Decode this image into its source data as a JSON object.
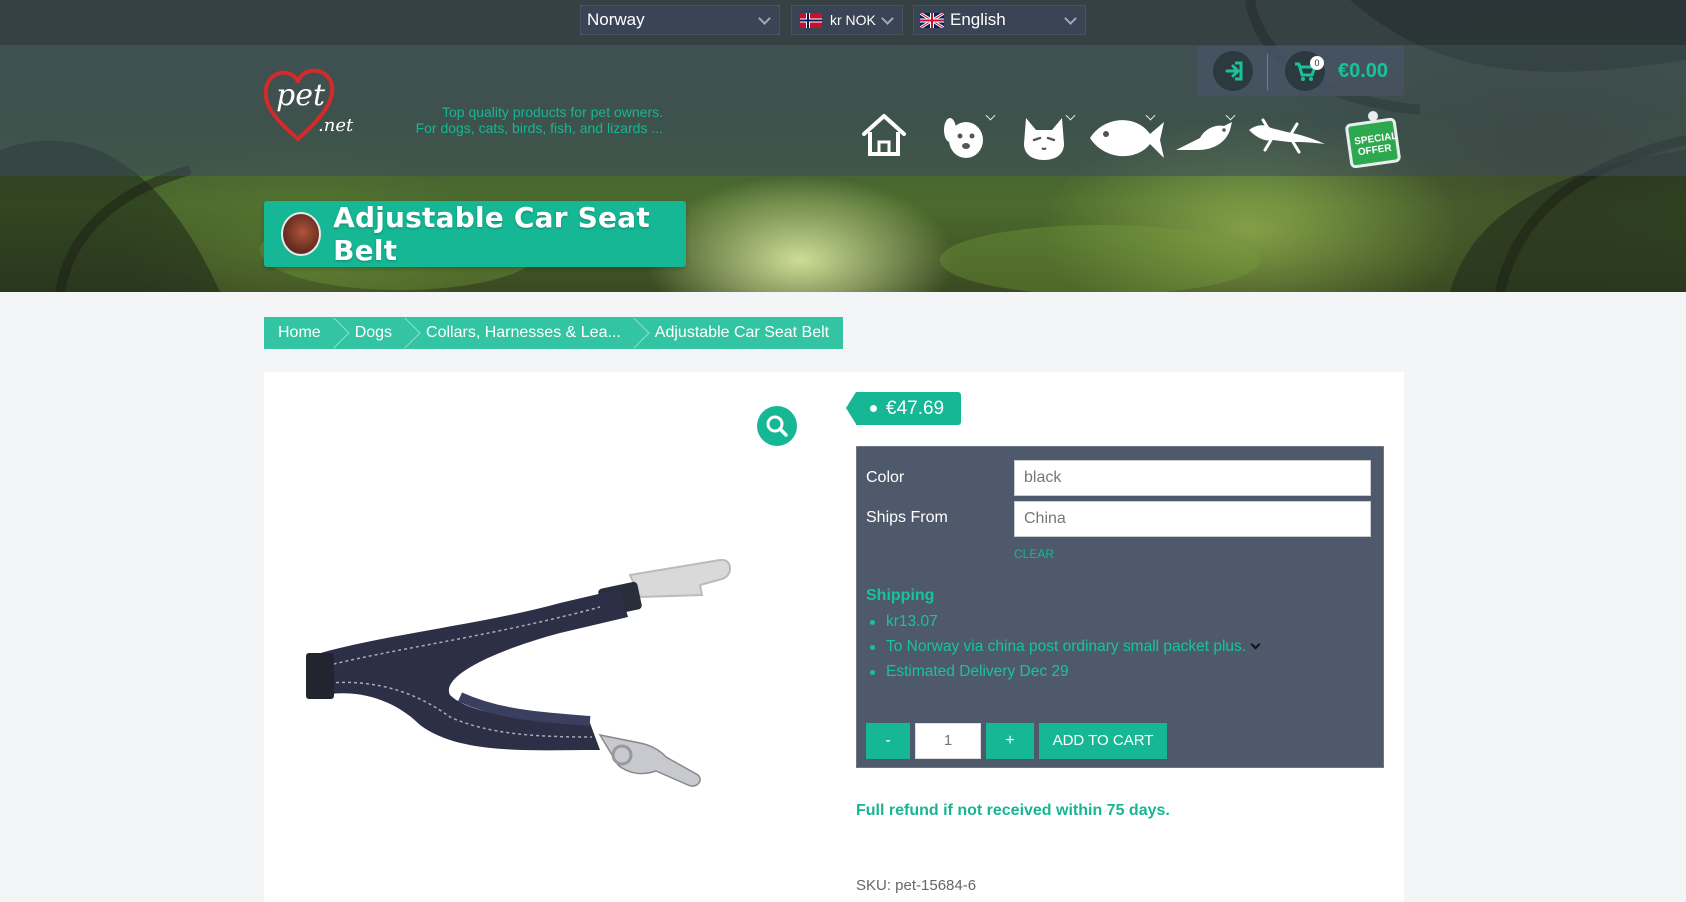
{
  "topbar": {
    "country": "Norway",
    "currency": "kr NOK",
    "language": "English"
  },
  "header": {
    "logo_alt": "pet.net",
    "tagline_line1": "Top quality products for pet owners.",
    "tagline_line2": "For dogs, cats, birds, fish, and lizards ...",
    "cart_count": "0",
    "cart_total": "€0.00"
  },
  "nav": {
    "items": [
      "home-icon",
      "dog-icon",
      "cat-icon",
      "fish-icon",
      "bird-icon",
      "lizard-icon",
      "special-offer-icon"
    ],
    "special_offer_line1": "SPECIAL",
    "special_offer_line2": "OFFER"
  },
  "page": {
    "title": "Adjustable Car Seat Belt"
  },
  "breadcrumb": [
    "Home",
    "Dogs",
    "Collars, Harnesses & Lea...",
    "Adjustable Car Seat Belt"
  ],
  "product": {
    "price": "€47.69",
    "options": {
      "color_label": "Color",
      "color_value": "black",
      "ships_from_label": "Ships From",
      "ships_from_value": "China",
      "clear_label": "CLEAR"
    },
    "shipping": {
      "title": "Shipping",
      "items": [
        "kr13.07",
        "To Norway via china post ordinary small packet plus.",
        "Estimated Delivery Dec 29"
      ]
    },
    "quantity": {
      "minus": "-",
      "value": "1",
      "plus": "+",
      "add_to_cart": "ADD TO CART"
    },
    "refund_note": "Full refund if not received within 75 days.",
    "sku": "SKU: pet-15684-6"
  },
  "colors": {
    "accent": "#16b794",
    "panel": "#4e5a6c"
  }
}
